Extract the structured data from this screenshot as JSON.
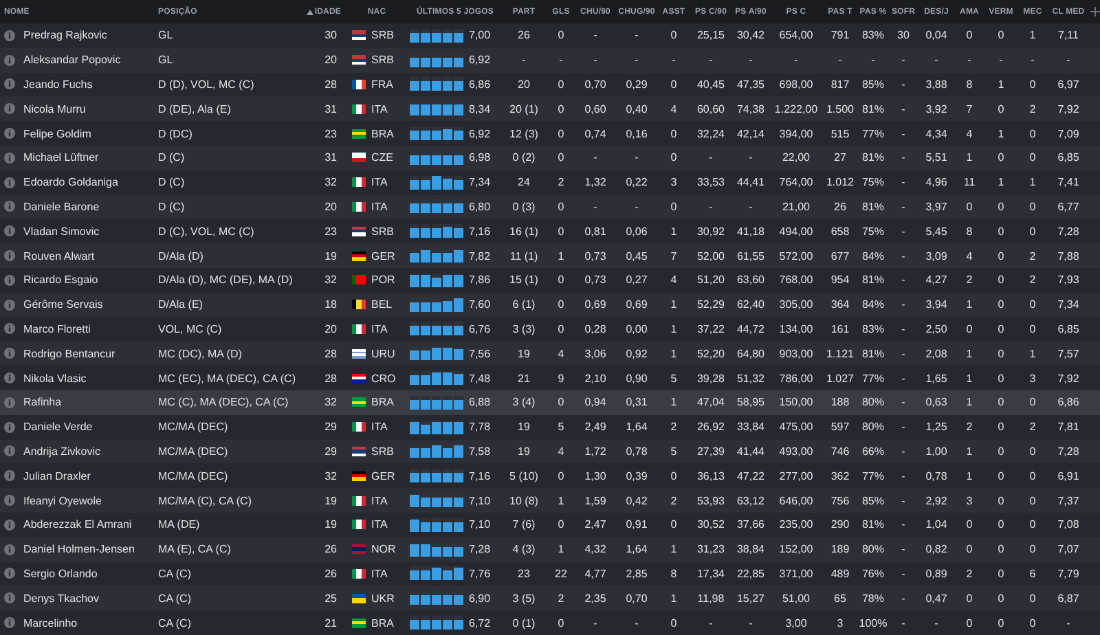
{
  "columns": [
    {
      "label": "NOME",
      "sorted": false
    },
    {
      "label": "POSIÇÃO",
      "sorted": false
    },
    {
      "label": "IDADE",
      "sorted": true
    },
    {
      "label": "NAC",
      "sorted": false
    },
    {
      "label": "ÚLTIMOS 5 JOGOS",
      "sorted": false
    },
    {
      "label": "PART",
      "sorted": false
    },
    {
      "label": "GLS",
      "sorted": false
    },
    {
      "label": "CHU/90",
      "sorted": false
    },
    {
      "label": "CHUG/90",
      "sorted": false
    },
    {
      "label": "ASST",
      "sorted": false
    },
    {
      "label": "PS C/90",
      "sorted": false
    },
    {
      "label": "PS A/90",
      "sorted": false
    },
    {
      "label": "PS C",
      "sorted": false
    },
    {
      "label": "PAS T",
      "sorted": false
    },
    {
      "label": "PAS %",
      "sorted": false
    },
    {
      "label": "SOFR",
      "sorted": false
    },
    {
      "label": "DES/J",
      "sorted": false
    },
    {
      "label": "AMA",
      "sorted": false
    },
    {
      "label": "VERM",
      "sorted": false
    },
    {
      "label": "MEC",
      "sorted": false
    },
    {
      "label": "CL MED",
      "sorted": false
    }
  ],
  "rows": [
    {
      "name": "Predrag Rajkovic",
      "position": "GL",
      "age": "30",
      "nation": "SRB",
      "flag": {
        "kind": "horizontal",
        "stripes": [
          {
            "color": "#c6363c"
          },
          {
            "color": "#0c4076"
          },
          {
            "color": "#ffffff"
          }
        ]
      },
      "form": [
        {
          "level": 0.7
        },
        {
          "level": 0.7
        },
        {
          "level": 0.7
        },
        {
          "level": 0.7
        },
        {
          "level": 0.7
        }
      ],
      "rating": "7,00",
      "highlighted": false,
      "stats": [
        "26",
        "0",
        "-",
        "-",
        "0",
        "25,15",
        "30,42",
        "654,00",
        "791",
        "83%",
        "30",
        "0,04",
        "0",
        "0",
        "1",
        "7,11"
      ]
    },
    {
      "name": "Aleksandar Popovic",
      "position": "GL",
      "age": "20",
      "nation": "SRB",
      "flag": {
        "kind": "horizontal",
        "stripes": [
          {
            "color": "#c6363c"
          },
          {
            "color": "#0c4076"
          },
          {
            "color": "#ffffff"
          }
        ]
      },
      "form": [
        {
          "level": 0.7
        },
        {
          "level": 0.7
        },
        {
          "level": 0.7
        },
        {
          "level": 0.7
        },
        {
          "level": 0.7
        }
      ],
      "rating": "6,92",
      "highlighted": false,
      "stats": [
        "-",
        "-",
        "-",
        "-",
        "-",
        "-",
        "-",
        "-",
        "-",
        "-",
        "-",
        "-",
        "-",
        "-",
        "-",
        "-"
      ]
    },
    {
      "name": "Jeando Fuchs",
      "position": "D (D), VOL, MC (C)",
      "age": "28",
      "nation": "FRA",
      "flag": {
        "kind": "vertical",
        "stripes": [
          {
            "color": "#0055a4"
          },
          {
            "color": "#ffffff"
          },
          {
            "color": "#ef4135"
          }
        ]
      },
      "form": [
        {
          "level": 0.7
        },
        {
          "level": 0.7
        },
        {
          "level": 0.7
        },
        {
          "level": 0.7
        },
        {
          "level": 0.75
        }
      ],
      "rating": "6,86",
      "highlighted": false,
      "stats": [
        "20",
        "0",
        "0,70",
        "0,29",
        "0",
        "40,45",
        "47,35",
        "698,00",
        "817",
        "85%",
        "-",
        "3,88",
        "8",
        "1",
        "0",
        "6,97"
      ]
    },
    {
      "name": "Nicola Murru",
      "position": "D (DE), Ala (E)",
      "age": "31",
      "nation": "ITA",
      "flag": {
        "kind": "vertical",
        "stripes": [
          {
            "color": "#009246"
          },
          {
            "color": "#ffffff"
          },
          {
            "color": "#ce2b37"
          }
        ]
      },
      "form": [
        {
          "level": 0.8
        },
        {
          "level": 0.8
        },
        {
          "level": 0.8
        },
        {
          "level": 0.8
        },
        {
          "level": 0.8
        }
      ],
      "rating": "8,34",
      "highlighted": false,
      "stats": [
        "20 (1)",
        "0",
        "0,60",
        "0,40",
        "4",
        "60,60",
        "74,38",
        "1.222,00",
        "1.500",
        "81%",
        "-",
        "3,92",
        "7",
        "0",
        "2",
        "7,92"
      ]
    },
    {
      "name": "Felipe Goldim",
      "position": "D (DC)",
      "age": "23",
      "nation": "BRA",
      "flag": {
        "kind": "horizontal",
        "stripes": [
          {
            "color": "#009c3b"
          },
          {
            "color": "#ffdf00"
          },
          {
            "color": "#009c3b"
          }
        ]
      },
      "form": [
        {
          "level": 0.7
        },
        {
          "level": 0.7
        },
        {
          "level": 0.7
        },
        {
          "level": 0.85
        },
        {
          "level": 0.7
        }
      ],
      "rating": "6,92",
      "highlighted": false,
      "stats": [
        "12 (3)",
        "0",
        "0,74",
        "0,16",
        "0",
        "32,24",
        "42,14",
        "394,00",
        "515",
        "77%",
        "-",
        "4,34",
        "4",
        "1",
        "0",
        "7,09"
      ]
    },
    {
      "name": "Michael Lüftner",
      "position": "D (C)",
      "age": "31",
      "nation": "CZE",
      "flag": {
        "kind": "horizontal",
        "stripes": [
          {
            "color": "#ffffff"
          },
          {
            "color": "#d7141a"
          }
        ]
      },
      "form": [
        {
          "level": 0.7
        },
        {
          "level": 0.7
        },
        {
          "level": 0.7
        },
        {
          "level": 0.7
        },
        {
          "level": 0.7
        }
      ],
      "rating": "6,98",
      "highlighted": false,
      "stats": [
        "0 (2)",
        "0",
        "-",
        "-",
        "0",
        "-",
        "-",
        "22,00",
        "27",
        "81%",
        "-",
        "5,51",
        "1",
        "0",
        "0",
        "6,85"
      ]
    },
    {
      "name": "Edoardo Goldaniga",
      "position": "D (C)",
      "age": "32",
      "nation": "ITA",
      "flag": {
        "kind": "vertical",
        "stripes": [
          {
            "color": "#009246"
          },
          {
            "color": "#ffffff"
          },
          {
            "color": "#ce2b37"
          }
        ]
      },
      "form": [
        {
          "level": 0.7
        },
        {
          "level": 0.7
        },
        {
          "level": 0.95
        },
        {
          "level": 0.75
        },
        {
          "level": 0.7
        }
      ],
      "rating": "7,34",
      "highlighted": false,
      "stats": [
        "24",
        "2",
        "1,32",
        "0,22",
        "3",
        "33,53",
        "44,41",
        "764,00",
        "1.012",
        "75%",
        "-",
        "4,96",
        "11",
        "1",
        "1",
        "7,41"
      ]
    },
    {
      "name": "Daniele Barone",
      "position": "D (C)",
      "age": "20",
      "nation": "ITA",
      "flag": {
        "kind": "vertical",
        "stripes": [
          {
            "color": "#009246"
          },
          {
            "color": "#ffffff"
          },
          {
            "color": "#ce2b37"
          }
        ]
      },
      "form": [
        {
          "level": 0.7
        },
        {
          "level": 0.7
        },
        {
          "level": 0.7
        },
        {
          "level": 0.7
        },
        {
          "level": 0.7
        }
      ],
      "rating": "6,80",
      "highlighted": false,
      "stats": [
        "0 (3)",
        "0",
        "-",
        "-",
        "0",
        "-",
        "-",
        "21,00",
        "26",
        "81%",
        "-",
        "3,97",
        "0",
        "0",
        "0",
        "6,77"
      ]
    },
    {
      "name": "Vladan Simovic",
      "position": "D (C), VOL, MC (C)",
      "age": "23",
      "nation": "SRB",
      "flag": {
        "kind": "horizontal",
        "stripes": [
          {
            "color": "#c6363c"
          },
          {
            "color": "#0c4076"
          },
          {
            "color": "#ffffff"
          }
        ]
      },
      "form": [
        {
          "level": 0.7
        },
        {
          "level": 0.7
        },
        {
          "level": 0.7
        },
        {
          "level": 0.85
        },
        {
          "level": 0.7
        }
      ],
      "rating": "7,16",
      "highlighted": false,
      "stats": [
        "16 (1)",
        "0",
        "0,81",
        "0,06",
        "1",
        "30,92",
        "41,18",
        "494,00",
        "658",
        "75%",
        "-",
        "5,45",
        "8",
        "0",
        "0",
        "7,28"
      ]
    },
    {
      "name": "Rouven Alwart",
      "position": "D/Ala (D)",
      "age": "19",
      "nation": "GER",
      "flag": {
        "kind": "horizontal",
        "stripes": [
          {
            "color": "#000000"
          },
          {
            "color": "#dd0000"
          },
          {
            "color": "#ffce00"
          }
        ]
      },
      "form": [
        {
          "level": 0.7
        },
        {
          "level": 0.9
        },
        {
          "level": 0.7
        },
        {
          "level": 0.7
        },
        {
          "level": 0.9
        }
      ],
      "rating": "7,82",
      "highlighted": false,
      "stats": [
        "11 (1)",
        "1",
        "0,73",
        "0,45",
        "7",
        "52,00",
        "61,55",
        "572,00",
        "677",
        "84%",
        "-",
        "3,09",
        "4",
        "0",
        "2",
        "7,88"
      ]
    },
    {
      "name": "Ricardo Esgaio",
      "position": "D/Ala (D), MC (DE), MA (D)",
      "age": "32",
      "nation": "POR",
      "flag": {
        "kind": "vertical",
        "stripes": [
          {
            "color": "#006600"
          },
          {
            "color": "#ff0000"
          },
          {
            "color": "#ff0000"
          }
        ]
      },
      "form": [
        {
          "level": 0.9
        },
        {
          "level": 0.9
        },
        {
          "level": 0.7
        },
        {
          "level": 0.9
        },
        {
          "level": 0.9
        }
      ],
      "rating": "7,86",
      "highlighted": false,
      "stats": [
        "15 (1)",
        "0",
        "0,73",
        "0,27",
        "4",
        "51,20",
        "63,60",
        "768,00",
        "954",
        "81%",
        "-",
        "4,27",
        "2",
        "0",
        "2",
        "7,93"
      ]
    },
    {
      "name": "Gérôme Servais",
      "position": "D/Ala (E)",
      "age": "18",
      "nation": "BEL",
      "flag": {
        "kind": "vertical",
        "stripes": [
          {
            "color": "#000000"
          },
          {
            "color": "#fdda24"
          },
          {
            "color": "#ef3340"
          }
        ]
      },
      "form": [
        {
          "level": 0.7
        },
        {
          "level": 0.7
        },
        {
          "level": 0.7
        },
        {
          "level": 0.75
        },
        {
          "level": 0.95
        }
      ],
      "rating": "7,60",
      "highlighted": false,
      "stats": [
        "6 (1)",
        "0",
        "0,69",
        "0,69",
        "1",
        "52,29",
        "62,40",
        "305,00",
        "364",
        "84%",
        "-",
        "3,94",
        "1",
        "0",
        "0",
        "7,34"
      ]
    },
    {
      "name": "Marco Floretti",
      "position": "VOL, MC (C)",
      "age": "20",
      "nation": "ITA",
      "flag": {
        "kind": "vertical",
        "stripes": [
          {
            "color": "#009246"
          },
          {
            "color": "#ffffff"
          },
          {
            "color": "#ce2b37"
          }
        ]
      },
      "form": [
        {
          "level": 0.7
        },
        {
          "level": 0.7
        },
        {
          "level": 0.7
        },
        {
          "level": 0.7
        },
        {
          "level": 0.7
        }
      ],
      "rating": "6,76",
      "highlighted": false,
      "stats": [
        "3 (3)",
        "0",
        "0,28",
        "0,00",
        "1",
        "37,22",
        "44,72",
        "134,00",
        "161",
        "83%",
        "-",
        "2,50",
        "0",
        "0",
        "0",
        "6,85"
      ]
    },
    {
      "name": "Rodrigo Bentancur",
      "position": "MC (DC), MA (D)",
      "age": "28",
      "nation": "URU",
      "flag": {
        "kind": "horizontal",
        "stripes": [
          {
            "color": "#ffffff"
          },
          {
            "color": "#7b9fd4"
          },
          {
            "color": "#ffffff"
          },
          {
            "color": "#7b9fd4"
          }
        ]
      },
      "form": [
        {
          "level": 0.7
        },
        {
          "level": 0.7
        },
        {
          "level": 0.9
        },
        {
          "level": 0.95
        },
        {
          "level": 0.8
        }
      ],
      "rating": "7,56",
      "highlighted": false,
      "stats": [
        "19",
        "4",
        "3,06",
        "0,92",
        "1",
        "52,20",
        "64,80",
        "903,00",
        "1.121",
        "81%",
        "-",
        "2,08",
        "1",
        "0",
        "1",
        "7,57"
      ]
    },
    {
      "name": "Nikola Vlasic",
      "position": "MC (EC), MA (DEC), CA (C)",
      "age": "28",
      "nation": "CRO",
      "flag": {
        "kind": "horizontal",
        "stripes": [
          {
            "color": "#ff0000"
          },
          {
            "color": "#ffffff"
          },
          {
            "color": "#171796"
          }
        ]
      },
      "form": [
        {
          "level": 0.7
        },
        {
          "level": 0.7
        },
        {
          "level": 0.9
        },
        {
          "level": 0.9
        },
        {
          "level": 0.8
        }
      ],
      "rating": "7,48",
      "highlighted": false,
      "stats": [
        "21",
        "9",
        "2,10",
        "0,90",
        "5",
        "39,28",
        "51,32",
        "786,00",
        "1.027",
        "77%",
        "-",
        "1,65",
        "1",
        "0",
        "3",
        "7,92"
      ]
    },
    {
      "name": "Rafinha",
      "position": "MC (C), MA (DEC), CA (C)",
      "age": "32",
      "nation": "BRA",
      "flag": {
        "kind": "horizontal",
        "stripes": [
          {
            "color": "#009c3b"
          },
          {
            "color": "#ffdf00"
          },
          {
            "color": "#009c3b"
          }
        ]
      },
      "form": [
        {
          "level": 0.7
        },
        {
          "level": 0.7
        },
        {
          "level": 0.7
        },
        {
          "level": 0.7
        },
        {
          "level": 0.7
        }
      ],
      "rating": "6,88",
      "highlighted": true,
      "stats": [
        "3 (4)",
        "0",
        "0,94",
        "0,31",
        "1",
        "47,04",
        "58,95",
        "150,00",
        "188",
        "80%",
        "-",
        "0,63",
        "1",
        "0",
        "0",
        "6,86"
      ]
    },
    {
      "name": "Daniele Verde",
      "position": "MC/MA (DEC)",
      "age": "29",
      "nation": "ITA",
      "flag": {
        "kind": "vertical",
        "stripes": [
          {
            "color": "#009246"
          },
          {
            "color": "#ffffff"
          },
          {
            "color": "#ce2b37"
          }
        ]
      },
      "form": [
        {
          "level": 0.9
        },
        {
          "level": 0.7
        },
        {
          "level": 0.85
        },
        {
          "level": 0.85
        },
        {
          "level": 0.85
        }
      ],
      "rating": "7,78",
      "highlighted": false,
      "stats": [
        "19",
        "5",
        "2,49",
        "1,64",
        "2",
        "26,92",
        "33,84",
        "475,00",
        "597",
        "80%",
        "-",
        "1,25",
        "2",
        "0",
        "2",
        "7,81"
      ]
    },
    {
      "name": "Andrija Zivkovic",
      "position": "MC/MA (DEC)",
      "age": "29",
      "nation": "SRB",
      "flag": {
        "kind": "horizontal",
        "stripes": [
          {
            "color": "#c6363c"
          },
          {
            "color": "#0c4076"
          },
          {
            "color": "#ffffff"
          }
        ]
      },
      "form": [
        {
          "level": 0.7
        },
        {
          "level": 0.7
        },
        {
          "level": 0.9
        },
        {
          "level": 0.7
        },
        {
          "level": 0.9
        }
      ],
      "rating": "7,58",
      "highlighted": false,
      "stats": [
        "19",
        "4",
        "1,72",
        "0,78",
        "5",
        "27,39",
        "41,44",
        "493,00",
        "746",
        "66%",
        "-",
        "1,00",
        "1",
        "0",
        "0",
        "7,28"
      ]
    },
    {
      "name": "Julian Draxler",
      "position": "MC/MA (DEC)",
      "age": "32",
      "nation": "GER",
      "flag": {
        "kind": "horizontal",
        "stripes": [
          {
            "color": "#000000"
          },
          {
            "color": "#dd0000"
          },
          {
            "color": "#ffce00"
          }
        ]
      },
      "form": [
        {
          "level": 0.7
        },
        {
          "level": 0.7
        },
        {
          "level": 0.7
        },
        {
          "level": 0.7
        },
        {
          "level": 0.7
        }
      ],
      "rating": "7,16",
      "highlighted": false,
      "stats": [
        "5 (10)",
        "0",
        "1,30",
        "0,39",
        "0",
        "36,13",
        "47,22",
        "277,00",
        "362",
        "77%",
        "-",
        "0,78",
        "1",
        "0",
        "0",
        "6,91"
      ]
    },
    {
      "name": "Ifeanyi Oyewole",
      "position": "MC/MA (C), CA (C)",
      "age": "19",
      "nation": "ITA",
      "flag": {
        "kind": "vertical",
        "stripes": [
          {
            "color": "#009246"
          },
          {
            "color": "#ffffff"
          },
          {
            "color": "#ce2b37"
          }
        ]
      },
      "form": [
        {
          "level": 0.9
        },
        {
          "level": 0.7
        },
        {
          "level": 0.7
        },
        {
          "level": 0.7
        },
        {
          "level": 0.7
        }
      ],
      "rating": "7,10",
      "highlighted": false,
      "stats": [
        "10 (8)",
        "1",
        "1,59",
        "0,42",
        "2",
        "53,93",
        "63,12",
        "646,00",
        "756",
        "85%",
        "-",
        "2,92",
        "3",
        "0",
        "0",
        "7,37"
      ]
    },
    {
      "name": "Abderezzak El Amrani",
      "position": "MA (DE)",
      "age": "19",
      "nation": "ITA",
      "flag": {
        "kind": "vertical",
        "stripes": [
          {
            "color": "#009246"
          },
          {
            "color": "#ffffff"
          },
          {
            "color": "#ce2b37"
          }
        ]
      },
      "form": [
        {
          "level": 0.9
        },
        {
          "level": 0.7
        },
        {
          "level": 0.7
        },
        {
          "level": 0.7
        },
        {
          "level": 0.7
        }
      ],
      "rating": "7,10",
      "highlighted": false,
      "stats": [
        "7 (6)",
        "0",
        "2,47",
        "0,91",
        "0",
        "30,52",
        "37,66",
        "235,00",
        "290",
        "81%",
        "-",
        "1,04",
        "0",
        "0",
        "0",
        "7,08"
      ]
    },
    {
      "name": "Daniel Holmen-Jensen",
      "position": "MA (E), CA (C)",
      "age": "26",
      "nation": "NOR",
      "flag": {
        "kind": "horizontal",
        "stripes": [
          {
            "color": "#ba0c2f"
          },
          {
            "color": "#00205b"
          },
          {
            "color": "#ba0c2f"
          }
        ]
      },
      "form": [
        {
          "level": 0.9
        },
        {
          "level": 0.9
        },
        {
          "level": 0.7
        },
        {
          "level": 0.7
        },
        {
          "level": 0.7
        }
      ],
      "rating": "7,28",
      "highlighted": false,
      "stats": [
        "4 (3)",
        "1",
        "4,32",
        "1,64",
        "1",
        "31,23",
        "38,84",
        "152,00",
        "189",
        "80%",
        "-",
        "0,82",
        "0",
        "0",
        "0",
        "7,07"
      ]
    },
    {
      "name": "Sergio Orlando",
      "position": "CA (C)",
      "age": "26",
      "nation": "ITA",
      "flag": {
        "kind": "vertical",
        "stripes": [
          {
            "color": "#009246"
          },
          {
            "color": "#ffffff"
          },
          {
            "color": "#ce2b37"
          }
        ]
      },
      "form": [
        {
          "level": 0.7
        },
        {
          "level": 0.7
        },
        {
          "level": 0.9
        },
        {
          "level": 0.7
        },
        {
          "level": 0.9
        }
      ],
      "rating": "7,76",
      "highlighted": false,
      "stats": [
        "23",
        "22",
        "4,77",
        "2,85",
        "8",
        "17,34",
        "22,85",
        "371,00",
        "489",
        "76%",
        "-",
        "0,89",
        "2",
        "0",
        "6",
        "7,79"
      ]
    },
    {
      "name": "Denys Tkachov",
      "position": "CA (C)",
      "age": "25",
      "nation": "UKR",
      "flag": {
        "kind": "horizontal",
        "stripes": [
          {
            "color": "#0057b7"
          },
          {
            "color": "#ffd700"
          }
        ]
      },
      "form": [
        {
          "level": 0.7
        },
        {
          "level": 0.7
        },
        {
          "level": 0.7
        },
        {
          "level": 0.7
        },
        {
          "level": 0.7
        }
      ],
      "rating": "6,90",
      "highlighted": false,
      "stats": [
        "3 (5)",
        "2",
        "2,35",
        "0,70",
        "1",
        "11,98",
        "15,27",
        "51,00",
        "65",
        "78%",
        "-",
        "0,47",
        "0",
        "0",
        "0",
        "6,87"
      ]
    },
    {
      "name": "Marcelinho",
      "position": "CA (C)",
      "age": "21",
      "nation": "BRA",
      "flag": {
        "kind": "horizontal",
        "stripes": [
          {
            "color": "#009c3b"
          },
          {
            "color": "#ffdf00"
          },
          {
            "color": "#009c3b"
          }
        ]
      },
      "form": [
        {
          "level": 0.7
        },
        {
          "level": 0.7
        },
        {
          "level": 0.7
        },
        {
          "level": 0.7
        },
        {
          "level": 0.7
        }
      ],
      "rating": "6,72",
      "highlighted": false,
      "stats": [
        "0 (1)",
        "0",
        "-",
        "-",
        "0",
        "-",
        "-",
        "3,00",
        "3",
        "100%",
        "-",
        "-",
        "0",
        "0",
        "0",
        "-"
      ]
    }
  ]
}
